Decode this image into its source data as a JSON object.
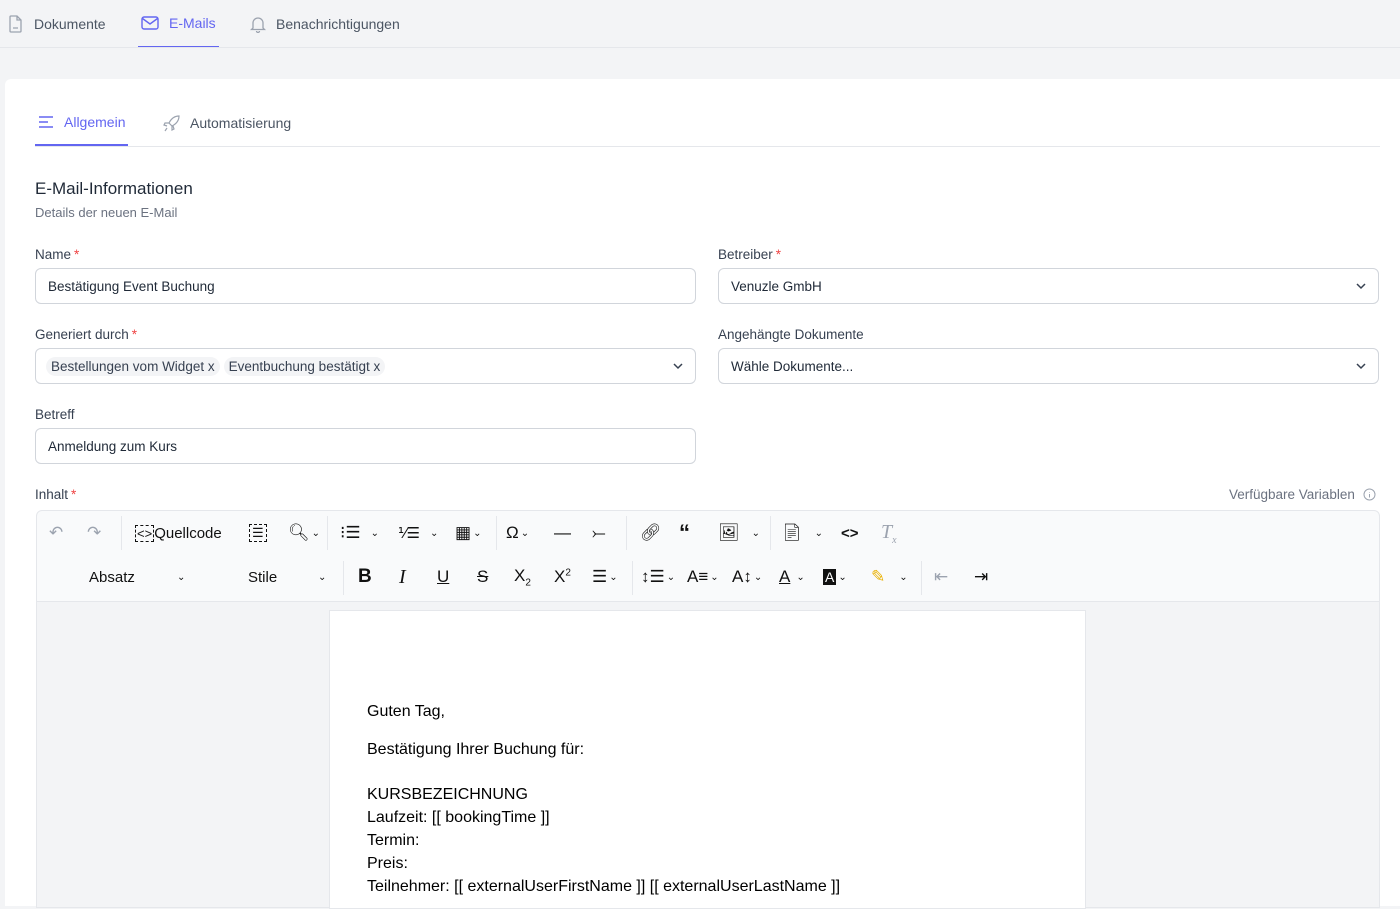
{
  "top_tabs": [
    {
      "label": "Dokumente",
      "icon": "document-icon"
    },
    {
      "label": "E-Mails",
      "icon": "mail-icon",
      "active": true
    },
    {
      "label": "Benachrichtigungen",
      "icon": "bell-icon"
    }
  ],
  "sub_tabs": [
    {
      "label": "Allgemein",
      "icon": "lines-icon",
      "active": true
    },
    {
      "label": "Automatisierung",
      "icon": "rocket-icon"
    }
  ],
  "section": {
    "title": "E-Mail-Informationen",
    "subtitle": "Details der neuen E-Mail"
  },
  "form": {
    "name_label": "Name",
    "name_value": "Bestätigung Event Buchung",
    "operator_label": "Betreiber",
    "operator_value": "Venuzle GmbH",
    "generated_label": "Generiert durch",
    "generated_chips": [
      "Bestellungen vom Widget",
      "Eventbuchung bestätigt"
    ],
    "chip_remove": "x",
    "attachments_label": "Angehängte Dokumente",
    "attachments_placeholder": "Wähle Dokumente...",
    "subject_label": "Betreff",
    "subject_value": "Anmeldung zum Kurs",
    "content_label": "Inhalt",
    "variables_label": "Verfügbare Variablen",
    "required_mark": "*"
  },
  "toolbar": {
    "source_label": "Quellcode",
    "block_label": "Absatz",
    "styles_label": "Stile"
  },
  "document": {
    "lines": [
      "Guten Tag,",
      "Bestätigung Ihrer Buchung für:",
      "KURSBEZEICHNUNG",
      "Laufzeit: [[ bookingTime ]]",
      "Termin:",
      "Preis:",
      "Teilnehmer: [[ externalUserFirstName ]] [[ externalUserLastName ]]"
    ]
  },
  "colors": {
    "accent": "#6366f1",
    "required": "#ef4444"
  }
}
